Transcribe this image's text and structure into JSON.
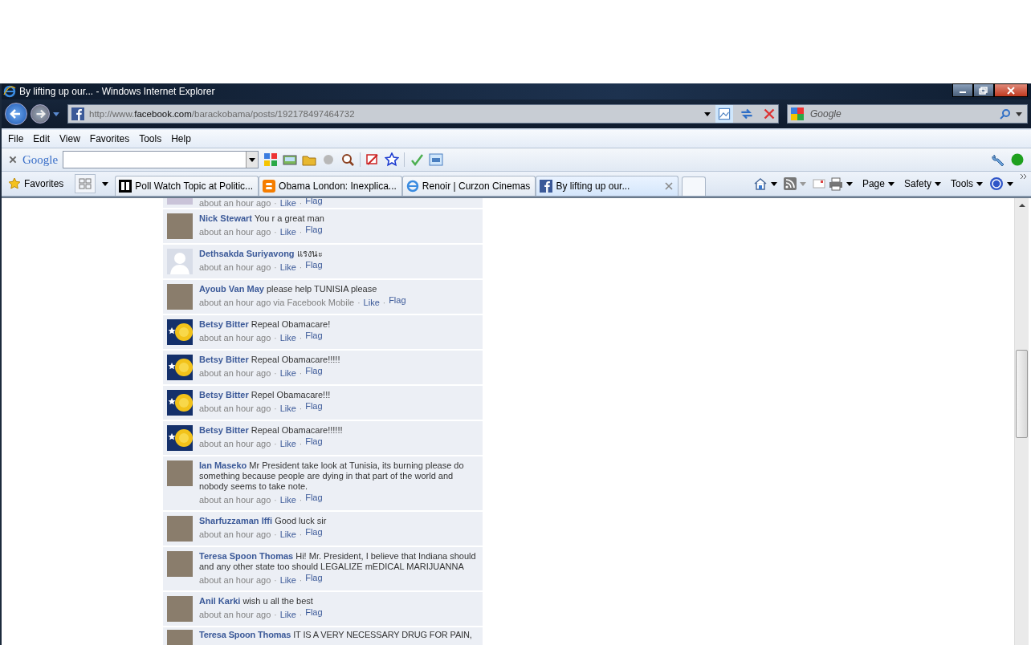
{
  "window": {
    "title": "By lifting up our... - Windows Internet Explorer"
  },
  "address_bar": {
    "url": "http://www.**facebook.com**/barackobama/posts/192178497464732"
  },
  "search_box": {
    "placeholder": "Google"
  },
  "menu": [
    "File",
    "Edit",
    "View",
    "Favorites",
    "Tools",
    "Help"
  ],
  "google_toolbar": {
    "logo": "Google"
  },
  "favorites_button": "Favorites",
  "tabs": [
    {
      "label": "Poll Watch Topic at Politic...",
      "kind": "pd",
      "selected": false
    },
    {
      "label": "Obama London: Inexplica...",
      "kind": "blogger",
      "selected": false
    },
    {
      "label": "Renoir | Curzon Cinemas",
      "kind": "ie",
      "selected": false
    },
    {
      "label": "By lifting up our...",
      "kind": "facebook",
      "selected": true
    }
  ],
  "command_bar": [
    "Page",
    "Safety",
    "Tools"
  ],
  "comments": [
    {
      "kind": "meta_only",
      "avatar": {
        "kind": "photo"
      },
      "time": "about an hour ago",
      "actions": [
        {
          "sep": "·",
          "label": "Like"
        },
        {
          "sep": "·",
          "label": "Flag"
        }
      ]
    },
    {
      "kind": "full",
      "avatar": {
        "kind": "photo"
      },
      "name": "Nick Stewart",
      "text": "You r a great man",
      "time": "about an hour ago",
      "actions": [
        {
          "sep": "·",
          "label": "Like"
        },
        {
          "sep": "·",
          "label": "Flag"
        }
      ]
    },
    {
      "kind": "full",
      "avatar": {
        "kind": "silhouette"
      },
      "name": "Dethsakda Suriyavong",
      "text": "แรงนะ",
      "time": "about an hour ago",
      "actions": [
        {
          "sep": "·",
          "label": "Like"
        },
        {
          "sep": "·",
          "label": "Flag"
        }
      ]
    },
    {
      "kind": "full",
      "avatar": {
        "kind": "photo"
      },
      "name": "Ayoub Van May",
      "text": "please help TUNISIA please",
      "time": "about an hour ago via Facebook Mobile",
      "actions": [
        {
          "sep": "·",
          "label": "Like"
        },
        {
          "sep": "·",
          "label": "Flag"
        }
      ]
    },
    {
      "kind": "full",
      "avatar": {
        "kind": "rose"
      },
      "name": "Betsy Bitter",
      "text": "Repeal Obamacare!",
      "time": "about an hour ago",
      "actions": [
        {
          "sep": "·",
          "label": "Like"
        },
        {
          "sep": "·",
          "label": "Flag"
        }
      ]
    },
    {
      "kind": "full",
      "avatar": {
        "kind": "rose"
      },
      "name": "Betsy Bitter",
      "text": "Repeal Obamacare!!!!!",
      "time": "about an hour ago",
      "actions": [
        {
          "sep": "·",
          "label": "Like"
        },
        {
          "sep": "·",
          "label": "Flag"
        }
      ]
    },
    {
      "kind": "full",
      "avatar": {
        "kind": "rose"
      },
      "name": "Betsy Bitter",
      "text": "Repel Obamacare!!!",
      "time": "about an hour ago",
      "actions": [
        {
          "sep": "·",
          "label": "Like"
        },
        {
          "sep": "·",
          "label": "Flag"
        }
      ]
    },
    {
      "kind": "full",
      "avatar": {
        "kind": "rose"
      },
      "name": "Betsy Bitter",
      "text": "Repeal Obamacare!!!!!!",
      "time": "about an hour ago",
      "actions": [
        {
          "sep": "·",
          "label": "Like"
        },
        {
          "sep": "·",
          "label": "Flag"
        }
      ]
    },
    {
      "kind": "full",
      "avatar": {
        "kind": "photo"
      },
      "name": "Ian Maseko",
      "text": "Mr President take look at Tunisia, its burning please do something because people are dying in that part of the world and nobody seems to take note.",
      "time": "about an hour ago",
      "actions": [
        {
          "sep": "·",
          "label": "Like"
        },
        {
          "sep": "·",
          "label": "Flag"
        }
      ]
    },
    {
      "kind": "full",
      "avatar": {
        "kind": "photo"
      },
      "name": "Sharfuzzaman Iffi",
      "text": "Good luck sir",
      "time": "about an hour ago",
      "actions": [
        {
          "sep": "·",
          "label": "Like"
        },
        {
          "sep": "·",
          "label": "Flag"
        }
      ]
    },
    {
      "kind": "full",
      "avatar": {
        "kind": "photo"
      },
      "name": "Teresa Spoon Thomas",
      "text": "Hi! Mr. President, I believe that Indiana should and any other state too should LEGALIZE mEDICAL MARIJUANNA",
      "time": "about an hour ago",
      "actions": [
        {
          "sep": "·",
          "label": "Like"
        },
        {
          "sep": "·",
          "label": "Flag"
        }
      ]
    },
    {
      "kind": "full",
      "avatar": {
        "kind": "photo"
      },
      "name": "Anil Karki",
      "text": "wish u all the best",
      "time": "about an hour ago",
      "actions": [
        {
          "sep": "·",
          "label": "Like"
        },
        {
          "sep": "·",
          "label": "Flag"
        }
      ]
    },
    {
      "kind": "header_only",
      "avatar": {
        "kind": "photo"
      },
      "name": "Teresa Spoon Thomas",
      "text": "IT IS A VERY NECESSARY DRUG FOR PAIN,"
    }
  ]
}
